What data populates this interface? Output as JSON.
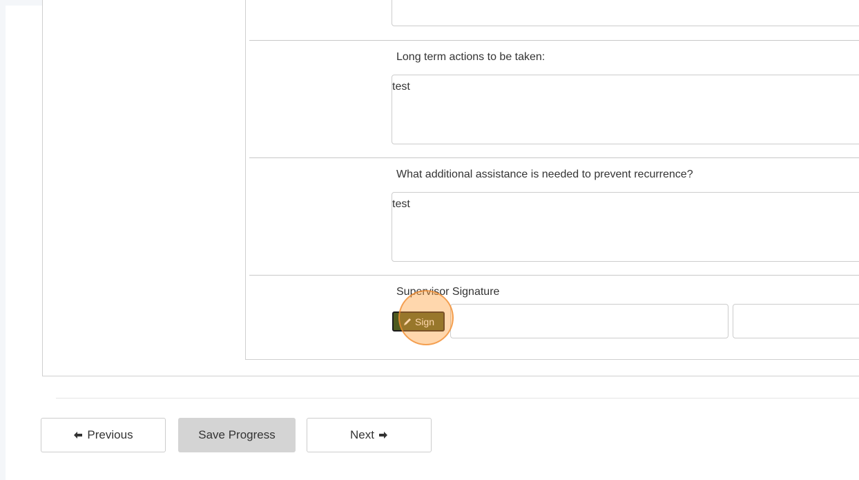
{
  "questions": [
    {
      "label": "Long term actions to be taken:",
      "answer": "test"
    },
    {
      "label": "What additional assistance is needed to prevent recurrence?",
      "answer": "test"
    }
  ],
  "signature": {
    "label": "Supervisor Signature",
    "sign_button_label": "Sign",
    "sign_icon": "pencil-icon",
    "button_color": "#4e5a1f"
  },
  "nav": {
    "previous_label": "Previous",
    "previous_icon": "arrow-left-icon",
    "save_label": "Save Progress",
    "next_label": "Next",
    "next_icon": "arrow-right-icon"
  }
}
